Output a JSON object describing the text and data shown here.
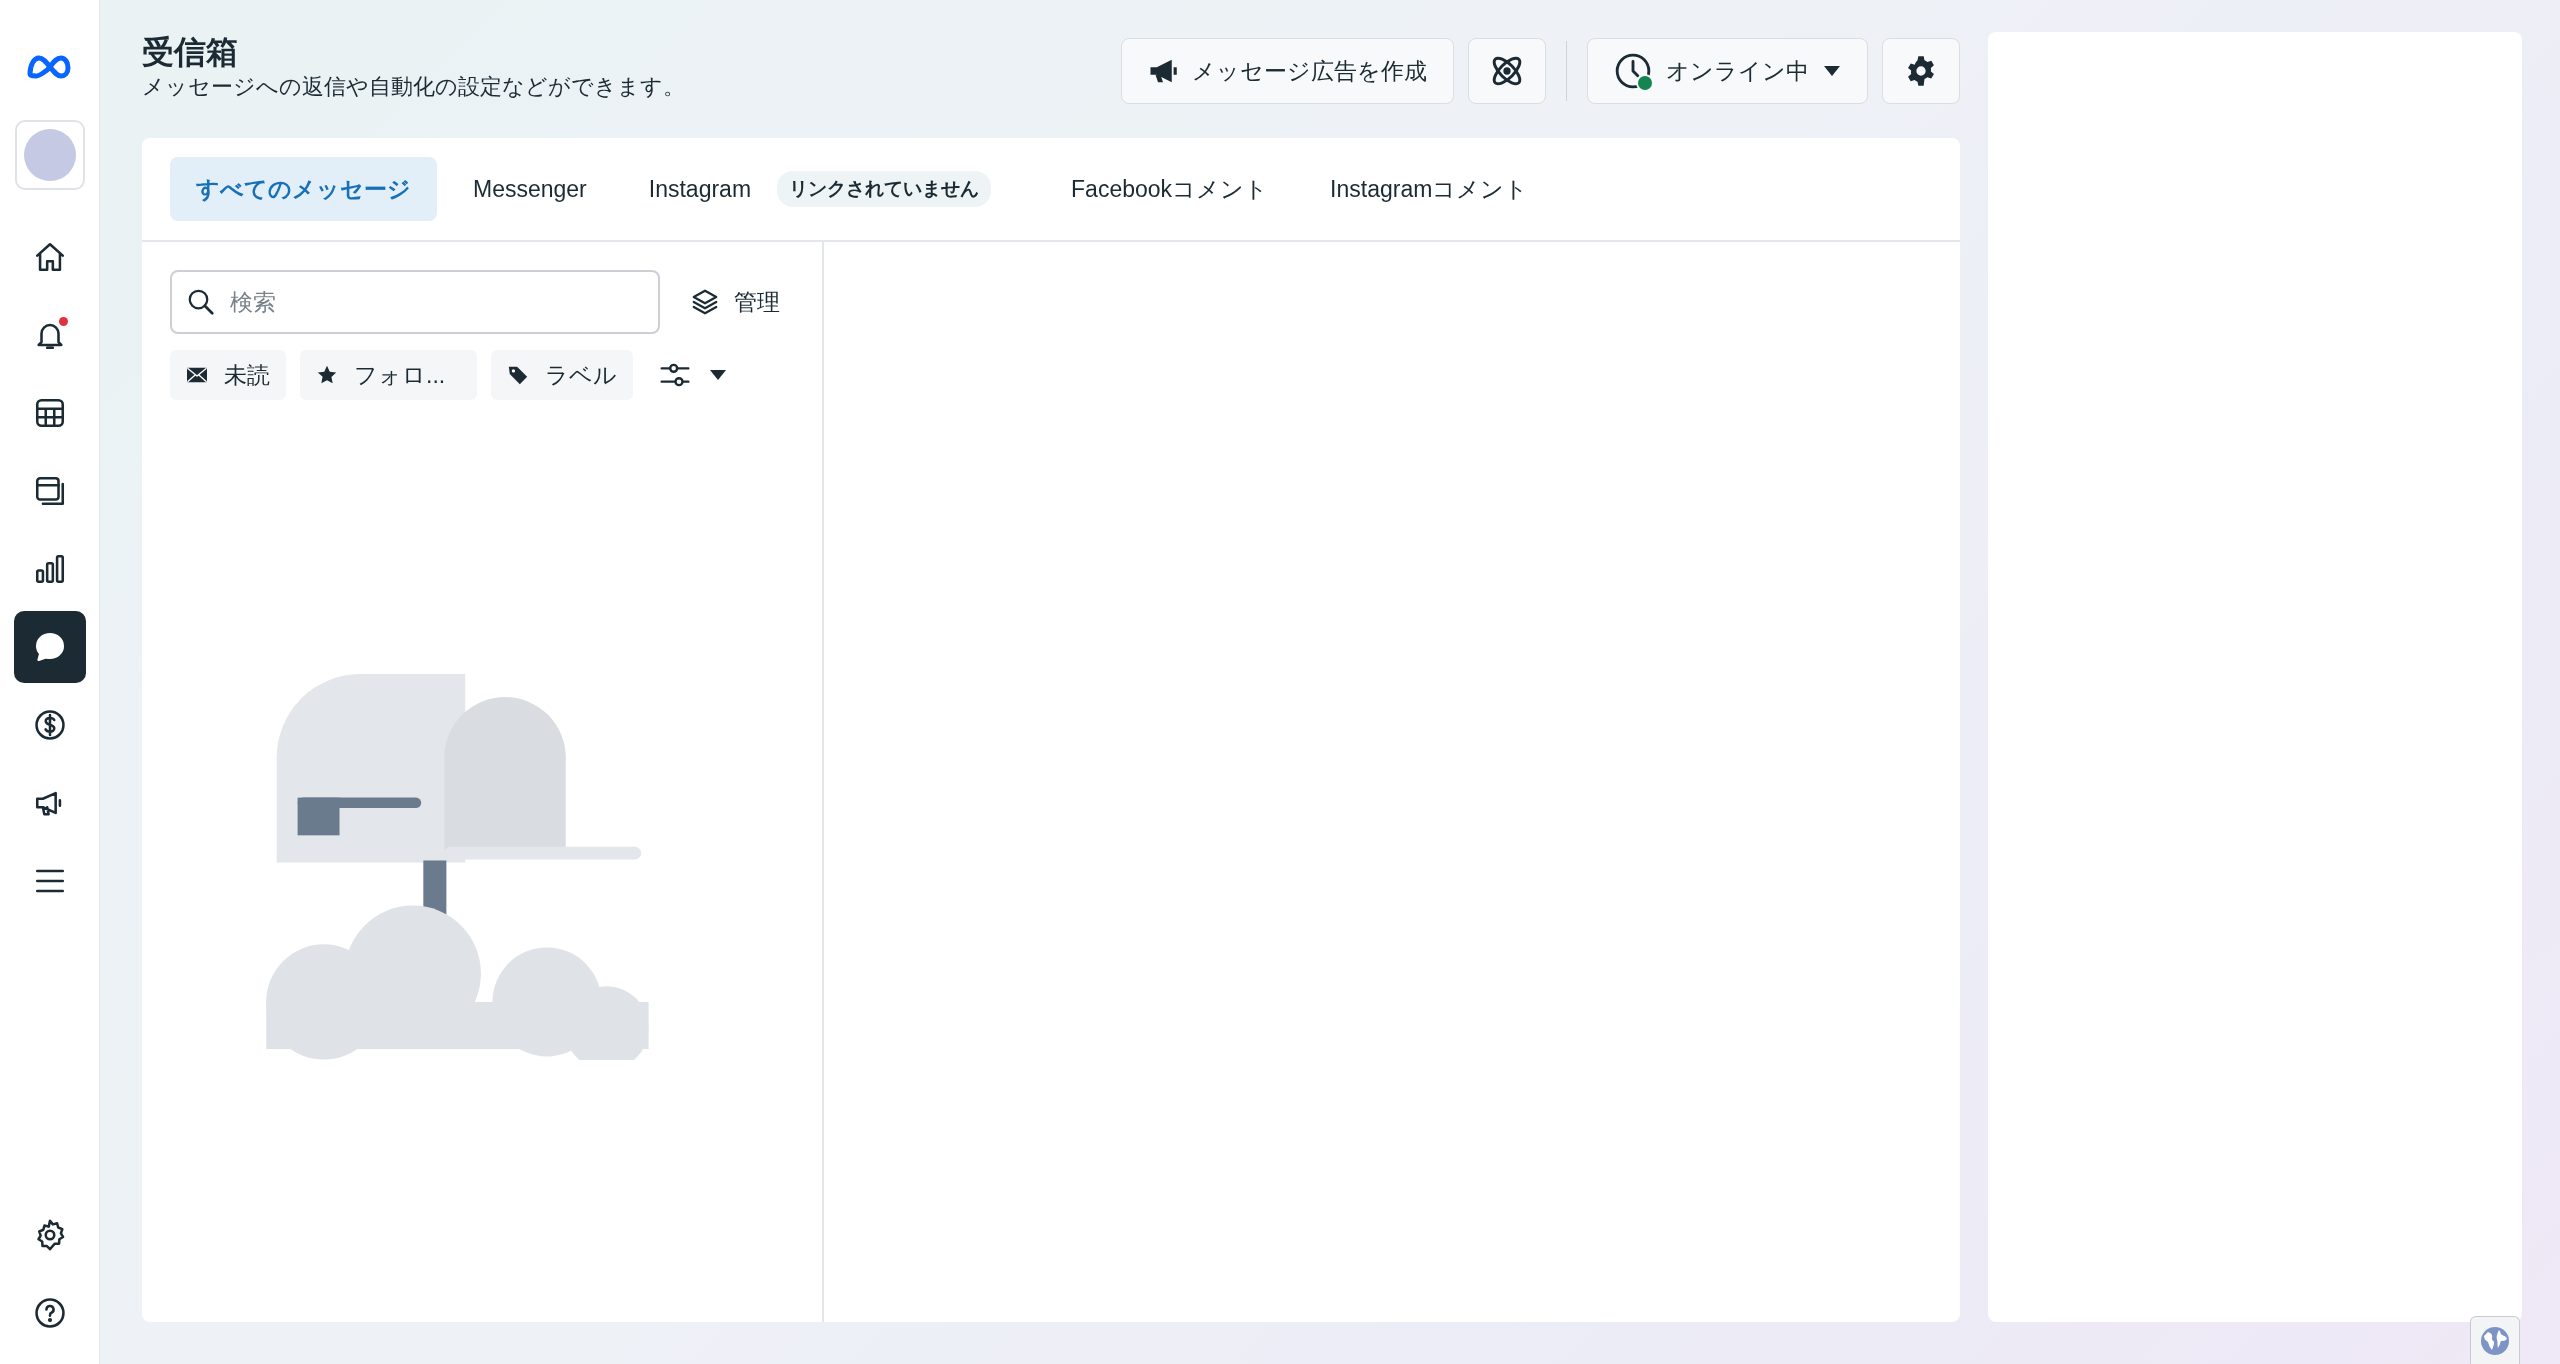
{
  "sidebar": {
    "items": [
      {
        "kind": "home",
        "selected": false,
        "notification": false
      },
      {
        "kind": "notifications",
        "selected": false,
        "notification": true
      },
      {
        "kind": "table",
        "selected": false,
        "notification": false
      },
      {
        "kind": "pages",
        "selected": false,
        "notification": false
      },
      {
        "kind": "insights",
        "selected": false,
        "notification": false
      },
      {
        "kind": "inbox",
        "selected": true,
        "notification": false
      },
      {
        "kind": "billing",
        "selected": false,
        "notification": false
      },
      {
        "kind": "ads",
        "selected": false,
        "notification": false
      },
      {
        "kind": "menu",
        "selected": false,
        "notification": false
      }
    ],
    "bottom_items": [
      {
        "kind": "settings"
      },
      {
        "kind": "help"
      }
    ]
  },
  "header": {
    "title": "受信箱",
    "subtitle": "メッセージへの返信や自動化の設定などができます。",
    "create_ad_button": "メッセージ広告を作成",
    "status_button": {
      "label": "オンライン中",
      "online": true
    }
  },
  "tabs": [
    {
      "label": "すべてのメッセージ",
      "selected": true
    },
    {
      "label": "Messenger",
      "selected": false
    },
    {
      "label": "Instagram",
      "selected": false,
      "badge": "リンクされていません"
    },
    {
      "label": "Facebookコメント",
      "selected": false
    },
    {
      "label": "Instagramコメント",
      "selected": false
    }
  ],
  "search": {
    "placeholder": "検索"
  },
  "manage_button": "管理",
  "filters": [
    {
      "kind": "unread",
      "label": "未読"
    },
    {
      "kind": "follow",
      "label": "フォロ..."
    },
    {
      "kind": "label",
      "label": "ラベル"
    }
  ]
}
